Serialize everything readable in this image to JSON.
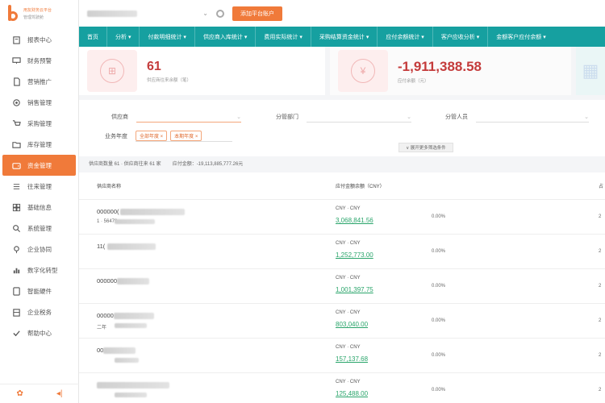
{
  "sidebar": {
    "logo_line1": "用友财务云平台",
    "logo_line2": "管理驾驶舱",
    "items": [
      {
        "label": "报表中心",
        "icon": "clipboard-icon",
        "active": false
      },
      {
        "label": "财务预警",
        "icon": "monitor-icon",
        "active": false
      },
      {
        "label": "营销推广",
        "icon": "document-icon",
        "active": false
      },
      {
        "label": "销售管理",
        "icon": "gear-icon",
        "active": false
      },
      {
        "label": "采购管理",
        "icon": "cart-icon",
        "active": false
      },
      {
        "label": "库存管理",
        "icon": "folder-icon",
        "active": false
      },
      {
        "label": "资金管理",
        "icon": "wallet-icon",
        "active": true
      },
      {
        "label": "往来管理",
        "icon": "list-icon",
        "active": false
      },
      {
        "label": "基础信息",
        "icon": "grid-icon",
        "active": false
      },
      {
        "label": "系统管理",
        "icon": "search-icon",
        "active": false
      },
      {
        "label": "企业协同",
        "icon": "link-icon",
        "active": false
      },
      {
        "label": "数字化转型",
        "icon": "chart-icon",
        "active": false
      },
      {
        "label": "智能硬件",
        "icon": "device-icon",
        "active": false
      },
      {
        "label": "企业税务",
        "icon": "building-icon",
        "active": false
      },
      {
        "label": "帮助中心",
        "icon": "check-icon",
        "active": false
      }
    ],
    "bottom_left_icon": "gear-icon",
    "bottom_right_icon": "collapse-icon"
  },
  "topbar": {
    "button_label": "添加平台账户"
  },
  "tabs": [
    "首页",
    "分析 ▾",
    "付款明细统计 ▾",
    "供应商入库统计 ▾",
    "费用实际统计 ▾",
    "采购结算资金统计 ▾",
    "应付余额统计 ▾",
    "客户应收分析 ▾",
    "金额客户应付余额 ▾"
  ],
  "stats": [
    {
      "value": "61",
      "label": "供应商往来余额（笔）"
    },
    {
      "value": "-1,911,388.58",
      "label": "应付余额（元）"
    }
  ],
  "filters": {
    "supplier_label": "供应商",
    "department_label": "分管部门",
    "person_label": "分管人员",
    "business_date_label": "业务年度",
    "chips": [
      "全部年度 ×",
      "本期年度 ×"
    ],
    "advanced_button": "∨ 展开更多筛选条件"
  },
  "summary": {
    "count_text": "供应商数量 61 · 供应商往来 61 家",
    "total_text": "应付金额：-19,113,885,777.26元"
  },
  "table": {
    "headers": [
      "供应商名称",
      "应付金额余额（CNY）",
      "占"
    ],
    "rows": [
      {
        "code": "000000(",
        "sub": "1 · 56479",
        "currency": "CNY · CNY",
        "amount": "3,068,841.56",
        "percent": "0.00%",
        "edge": "2"
      },
      {
        "code": "11(",
        "sub": "",
        "currency": "CNY · CNY",
        "amount": "1,252,773.00",
        "percent": "0.00%",
        "edge": "2"
      },
      {
        "code": "000000",
        "sub": "",
        "currency": "CNY · CNY",
        "amount": "1,001,397.75",
        "percent": "0.00%",
        "edge": "2"
      },
      {
        "code": "00000",
        "sub": "二年",
        "currency": "CNY · CNY",
        "amount": "803,040.00",
        "percent": "0.00%",
        "edge": "2"
      },
      {
        "code": "00",
        "sub": "",
        "currency": "CNY · CNY",
        "amount": "157,137.68",
        "percent": "0.00%",
        "edge": "2"
      },
      {
        "code": "",
        "sub": "",
        "currency": "CNY · CNY",
        "amount": "125,488.00",
        "percent": "0.00%",
        "edge": "2"
      }
    ]
  },
  "colors": {
    "accent": "#f07a3a",
    "teal": "#16a0a0",
    "negative": "#c43b3b",
    "link_green": "#2aa56b"
  }
}
